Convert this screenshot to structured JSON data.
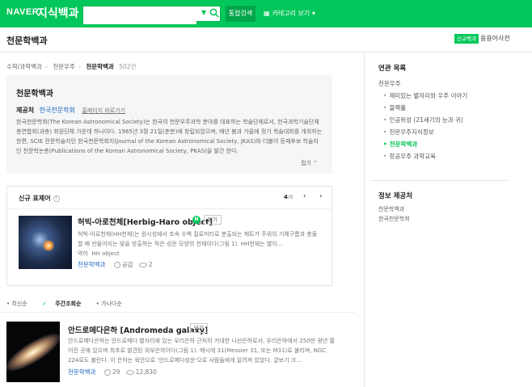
{
  "topbar": {
    "logo": "NAVER",
    "service": "지식백과",
    "search_value": "",
    "search_all": "통합검색",
    "category_view": "카테고리 보기"
  },
  "header": {
    "title": "천문학백과",
    "new_badge": "신규백과",
    "link": "용용어사전"
  },
  "breadcrumb": {
    "items": [
      "수학/과학백과",
      "천문우주",
      "천문학백과"
    ],
    "count": "502건"
  },
  "card": {
    "title": "천문학백과",
    "provider_label": "제공처",
    "provider": "한국천문학회",
    "go_link": "홈페이지 바로가기",
    "description": "한국천문학회(The Korean Astronomical Society)는 한국의 천문우주과학 분야를 대표하는 학술단체로서, 한국과학기술단체총연합회(과총) 회원단체 가운데 하나이다. 1965년 3월 21일(춘분)에 창립되었으며, 매년 봄과 가을에 정기 학술대회를 개최하는 한편, SCIE 전문학술지인 한국천문학회지(Journal of the Korean Astronomical Society, JKAS)와 더불어 등재후보 학술지인 천문학논총(Publications of the Korean Astronomical Society, PKAS)을 발간 한다.",
    "fold": "접기"
  },
  "new_show": {
    "title": "신규 표제어",
    "page_current": "4",
    "page_total": "/6",
    "entry": {
      "name": "허빅-아로천체[Herbig-Haro object]",
      "new_mark": "N",
      "save": "담기",
      "description": "허빅-아로천체(HH천체)는 원시성에서 초속 수백 킬로미터로 분출되는 제트가 주위의 기체구름과 충돌할 때 만들어지는 빛을 방출하는 작은 성운 모양의 천체이다(그림 1). HH천체는 별이...",
      "aka_label": "약어",
      "aka": "HH object",
      "source": "천문학백과",
      "likes_label": "공감",
      "views": "2"
    }
  },
  "sort": {
    "options": [
      "최신순",
      "주간조회순",
      "가나다순"
    ]
  },
  "list": [
    {
      "name": "안드로메다은하 [Andromeda galaxy]",
      "save": "담기",
      "description": "안드로메다은하는 안드로메다 별자리에 있는 우리은하 근처의 거대한 나선은하로서, 우리은하에서 250만 광년 떨어진 곳에 있으며 최초로 발견된 외부은하이다(그림 1). 메시에 31(Messier 31, 또는 M31)로 불리며, NGC 224로도 불린다. 이 은하는 육안으로 '안드로메다성운'으로 사람들에게 알려져 있었다. 겉보기 크...",
      "source": "천문학백과",
      "likes": "29",
      "views": "12,830"
    }
  ],
  "related": {
    "title": "연관 목록",
    "items": [
      {
        "label": "천문우주",
        "sub": false
      },
      {
        "label": "재미있는 별자리와 우주 이야기",
        "sub": true
      },
      {
        "label": "블랙홀",
        "sub": true
      },
      {
        "label": "인공위성 (21세기의 눈과 귀)",
        "sub": true
      },
      {
        "label": "천문우주지식정보",
        "sub": true
      },
      {
        "label": "천문학백과",
        "sub": true,
        "active": true
      },
      {
        "label": "항공우주 과학교육",
        "sub": true
      }
    ]
  },
  "info": {
    "title": "정보 제공처",
    "lines": [
      "천문학백과",
      "한국천문학회"
    ]
  }
}
